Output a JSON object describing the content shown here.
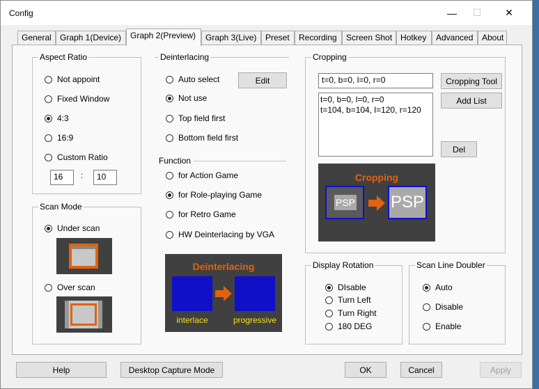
{
  "window": {
    "title": "Config"
  },
  "titlebar": {
    "minimize": "—",
    "maximize": "☐",
    "close": "✕"
  },
  "tabs": [
    {
      "label": "General"
    },
    {
      "label": "Graph 1(Device)"
    },
    {
      "label": "Graph 2(Preview)"
    },
    {
      "label": "Graph 3(Live)"
    },
    {
      "label": "Preset"
    },
    {
      "label": "Recording"
    },
    {
      "label": "Screen Shot"
    },
    {
      "label": "Hotkey"
    },
    {
      "label": "Advanced"
    },
    {
      "label": "About"
    }
  ],
  "aspect_ratio": {
    "label": "Aspect Ratio",
    "options": [
      "Not appoint",
      "Fixed Window",
      "4:3",
      "16:9",
      "Custom Ratio"
    ],
    "selected": "4:3",
    "custom_w": "16",
    "custom_sep": ":",
    "custom_h": "10"
  },
  "scan_mode": {
    "label": "Scan Mode",
    "options": [
      "Under scan",
      "Over scan"
    ],
    "selected": "Under scan"
  },
  "deinterlacing": {
    "label": "Deinterlacing",
    "options": [
      "Auto select",
      "Not use",
      "Top field first",
      "Bottom field first"
    ],
    "selected": "Not use",
    "edit_label": "Edit"
  },
  "function": {
    "label": "Function",
    "options": [
      "for Action Game",
      "for Role-playing Game",
      "for Retro Game",
      "HW Deinterlacing by VGA"
    ],
    "selected": "for Role-playing Game"
  },
  "deinterlace_illus": {
    "title": "Deinterlacing",
    "left": "interlace",
    "right": "progressive"
  },
  "cropping": {
    "label": "Cropping",
    "value": "t=0, b=0, l=0, r=0",
    "list": [
      "t=0, b=0, l=0, r=0",
      "t=104, b=104, l=120, r=120"
    ],
    "tool_label": "Cropping Tool",
    "add_label": "Add List",
    "del_label": "Del",
    "illus_title": "Cropping",
    "illus_text": "PSP"
  },
  "display_rotation": {
    "label": "Display Rotation",
    "options": [
      "DIsable",
      "Turn Left",
      "Turn Right",
      "180 DEG"
    ],
    "selected": "DIsable"
  },
  "scan_line_doubler": {
    "label": "Scan Line Doubler",
    "options": [
      "Auto",
      "Disable",
      "Enable"
    ],
    "selected": "Auto"
  },
  "bottom": {
    "help": "Help",
    "desktop": "Desktop Capture Mode",
    "ok": "OK",
    "cancel": "Cancel",
    "apply": "Apply"
  },
  "colors": {
    "illus_bg": "#404040",
    "orange": "#e2620f",
    "blue": "#1010c8",
    "yellow": "#f0e020"
  }
}
